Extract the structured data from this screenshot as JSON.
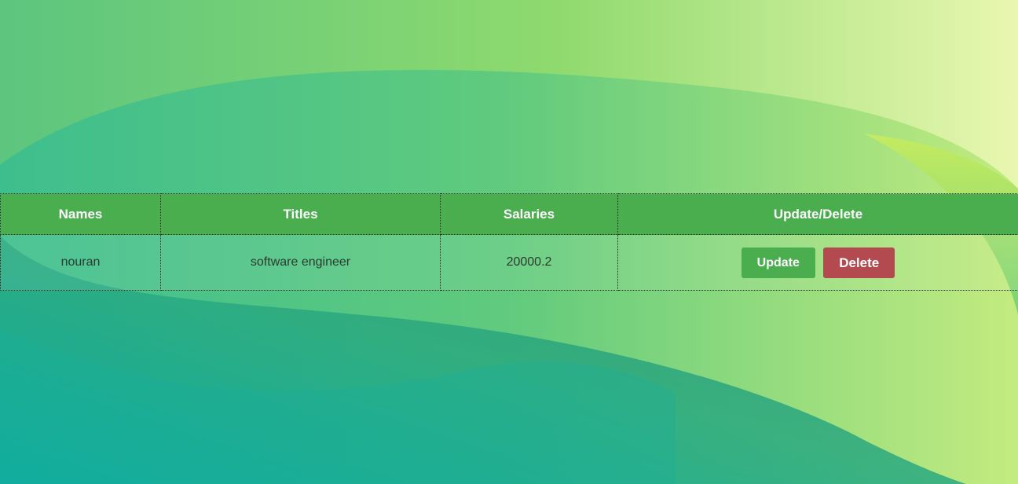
{
  "table": {
    "headers": [
      "Names",
      "Titles",
      "Salaries",
      "Update/Delete"
    ],
    "rows": [
      {
        "name": "nouran",
        "title": "software engineer",
        "salary": "20000.2",
        "update_label": "Update",
        "delete_label": "Delete"
      }
    ]
  },
  "colors": {
    "header_bg": "#4aad4e",
    "update_button": "#4aad4e",
    "delete_button": "#b34a4f"
  }
}
